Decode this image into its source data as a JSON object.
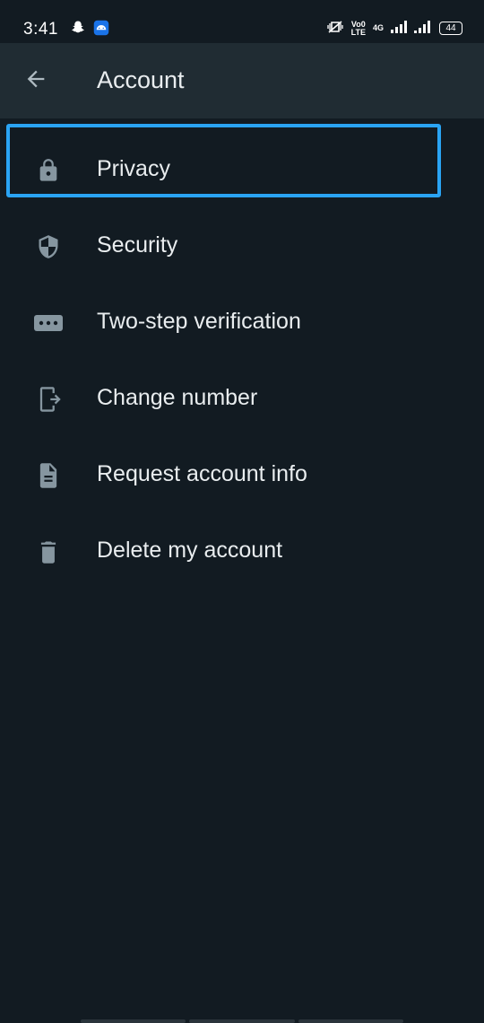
{
  "status_bar": {
    "time": "3:41",
    "left_icons": [
      "snapchat-icon",
      "app-notification-icon"
    ],
    "network_label_top": "Vo0",
    "network_label_bottom": "LTE",
    "network_type": "4G",
    "battery": "44"
  },
  "app_bar": {
    "title": "Account",
    "back_icon": "arrow-left-icon"
  },
  "menu": {
    "items": [
      {
        "label": "Privacy",
        "icon": "lock-icon",
        "highlighted": true
      },
      {
        "label": "Security",
        "icon": "shield-icon"
      },
      {
        "label": "Two-step verification",
        "icon": "password-dots-icon"
      },
      {
        "label": "Change number",
        "icon": "phone-exit-icon"
      },
      {
        "label": "Request account info",
        "icon": "document-icon"
      },
      {
        "label": "Delete my account",
        "icon": "trash-icon"
      }
    ]
  },
  "colors": {
    "background": "#121b22",
    "app_bar": "#202c33",
    "text": "#e9edef",
    "icon": "#8696a0",
    "highlight": "#2aa4f4"
  }
}
